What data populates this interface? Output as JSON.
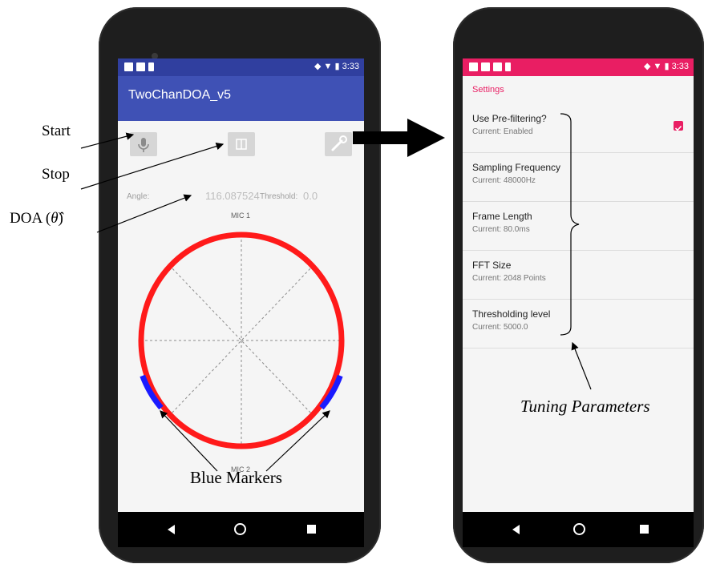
{
  "left_app": {
    "title": "TwoChanDOA_v5",
    "status_time": "3:33",
    "angle_label": "Angle:",
    "angle_value": "116.087524",
    "threshold_label": "Threshold:",
    "threshold_value": "0.0",
    "mic1_label": "MIC 1",
    "mic2_label": "MIC 2",
    "icons": {
      "start": "microphone-icon",
      "stop": "pause-icon",
      "settings": "wrench-icon"
    },
    "colors": {
      "appbar": "#3f51b5",
      "ring": "#ff1a1a",
      "marker": "#1a1aff"
    }
  },
  "right_app": {
    "status_time": "3:33",
    "header": "Settings",
    "items": [
      {
        "title": "Use Pre-filtering?",
        "summary": "Current: Enabled"
      },
      {
        "title": "Sampling Frequency",
        "summary": "Current: 48000Hz"
      },
      {
        "title": "Frame Length",
        "summary": "Current: 80.0ms"
      },
      {
        "title": "FFT Size",
        "summary": "Current: 2048 Points"
      },
      {
        "title": "Thresholding level",
        "summary": "Current: 5000.0"
      }
    ],
    "accent_color": "#e91e63"
  },
  "annotations": {
    "start": "Start",
    "stop": "Stop",
    "doa": "DOA (",
    "doa_symbol": "θ̂",
    "doa_close": ")",
    "blue_markers": "Blue Markers",
    "tuning": "Tuning Parameters"
  }
}
